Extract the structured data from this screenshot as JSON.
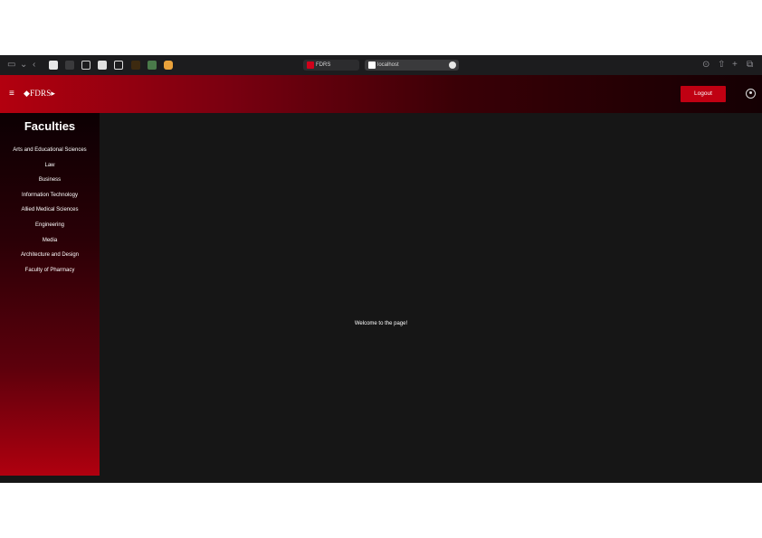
{
  "browser": {
    "tabs": [
      {
        "title": "FDRS",
        "favicon_color": "#d0021b"
      },
      {
        "title": "localhost",
        "favicon_color": "#ffffff"
      }
    ]
  },
  "header": {
    "menu_icon": "≡",
    "brand": "◆FDRS▸",
    "logout_label": "Logout",
    "user_icon": "user-circle-icon",
    "accent_color": "#c00012"
  },
  "sidebar": {
    "title": "Faculties",
    "items": [
      {
        "label": "Arts and Educational Sciences"
      },
      {
        "label": "Law"
      },
      {
        "label": "Business"
      },
      {
        "label": "Information Technology"
      },
      {
        "label": "Allied Medical Sciences"
      },
      {
        "label": "Engineering"
      },
      {
        "label": "Media"
      },
      {
        "label": "Architecture and Design"
      },
      {
        "label": "Faculty of Pharmacy"
      }
    ]
  },
  "main": {
    "welcome_text": "Welcome to the page!"
  }
}
